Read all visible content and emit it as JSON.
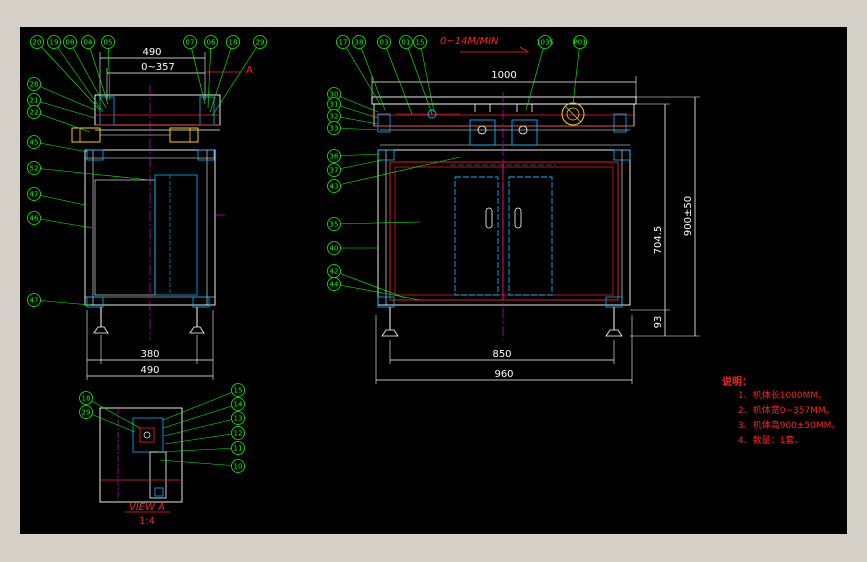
{
  "colors": {
    "background": "#000000",
    "frame_bg": "#d4d0c8",
    "outline": "#ffffff",
    "part": "#ff2020",
    "hidden": "#00b7ff",
    "center": "#ff00ff",
    "balloon": "#00ff00",
    "accent": "#ffd000"
  },
  "left_view": {
    "dim_top": "490",
    "dim_range": "0~357",
    "marker": "A",
    "dim_inner": "380",
    "dim_outer": "490",
    "top_balloons": [
      "20",
      "19",
      "08",
      "04",
      "05",
      "07",
      "06",
      "18",
      "29"
    ],
    "side_balloons": [
      "28",
      "21",
      "22",
      "45",
      "52",
      "47",
      "46",
      "47"
    ]
  },
  "front_view": {
    "speed": "0~14M/MIN",
    "dim_length": "1000",
    "dim_height_total": "900±50",
    "dim_height_top": "704.5",
    "dim_foot": "93",
    "dim_inner": "850",
    "dim_outer": "960",
    "top_balloons": [
      "17",
      "38",
      "03",
      "01",
      "15",
      "1035",
      "P01"
    ],
    "side_balloons": [
      "30",
      "31",
      "32",
      "33",
      "36",
      "37",
      "43",
      "35",
      "40",
      "42",
      "44"
    ]
  },
  "detail_view": {
    "title": "VIEW  A",
    "scale": "1:4",
    "left_balloons": [
      "18",
      "29"
    ],
    "right_balloons": [
      "15",
      "14",
      "13",
      "12",
      "11",
      "10"
    ]
  },
  "notes": {
    "heading": "说明：",
    "items": [
      "1、机体长1000MM。",
      "2、机体宽0~357MM。",
      "3、机体高900±50MM。",
      "4、数量：1套。"
    ]
  }
}
